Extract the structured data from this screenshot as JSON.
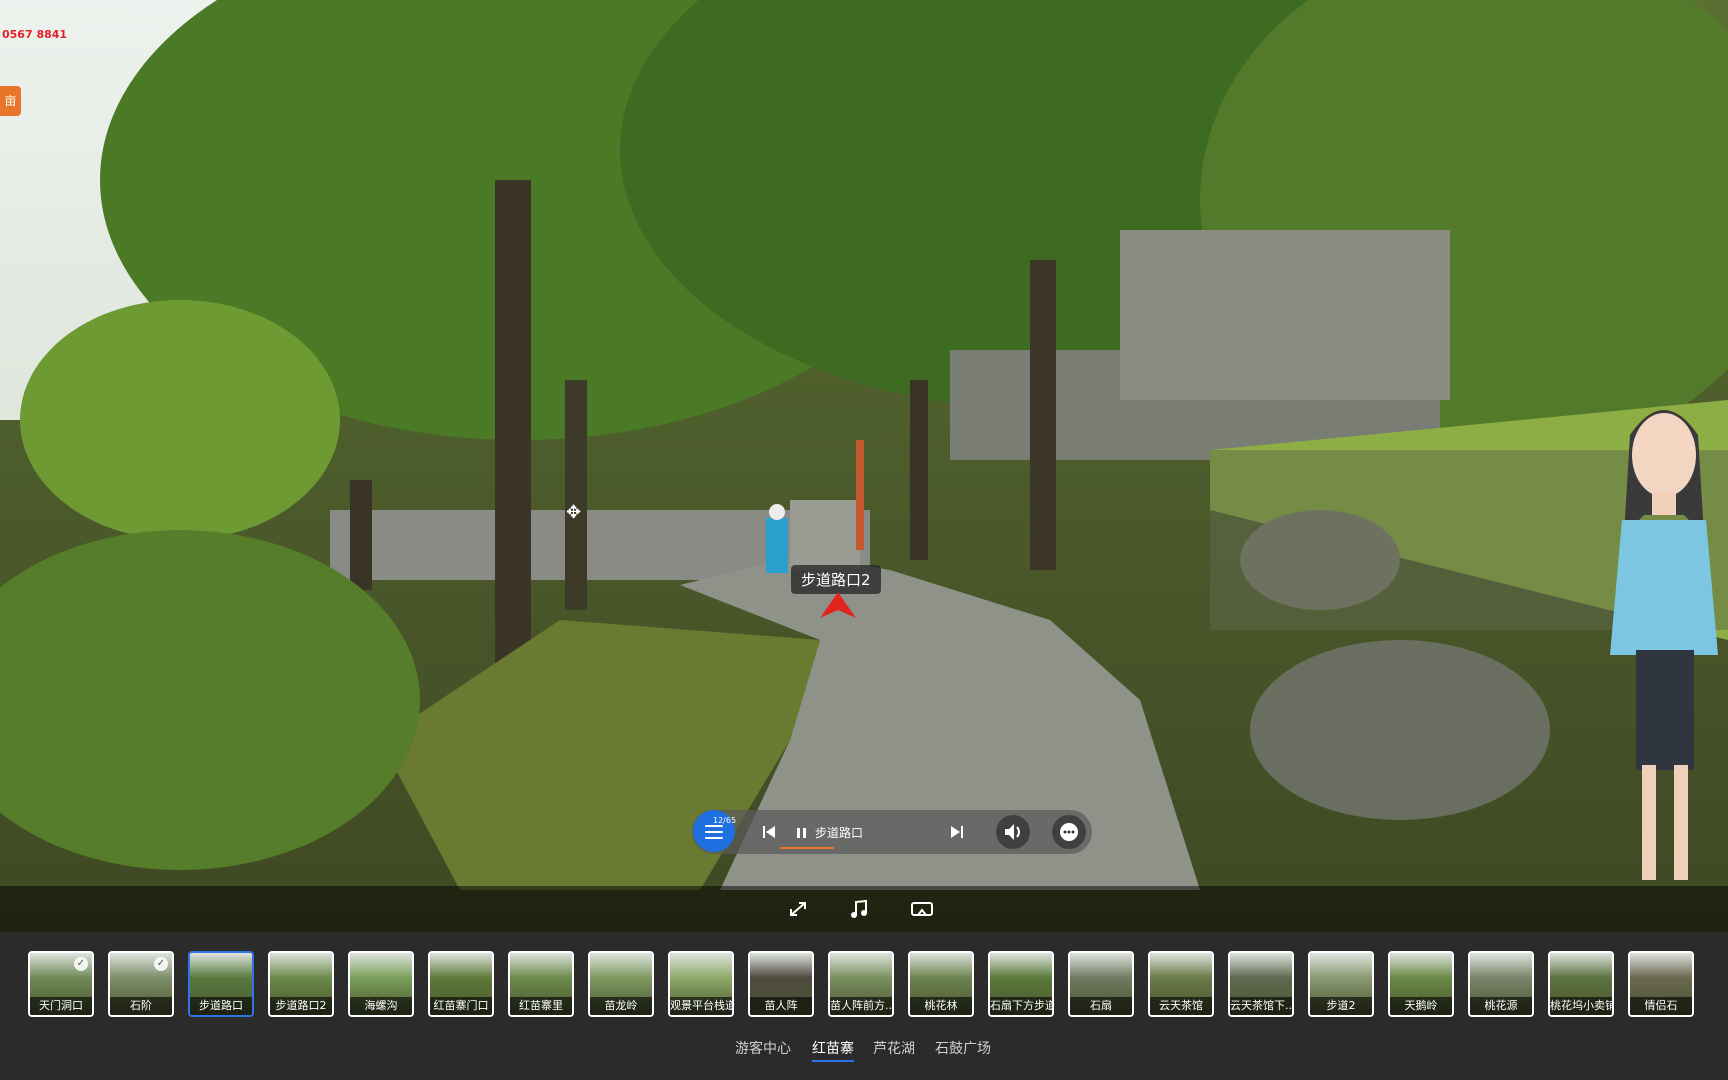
{
  "brand": {
    "logo_text": "0567 8841",
    "side_tab_text": "亩"
  },
  "hotspot": {
    "label": "步道路口2"
  },
  "player": {
    "counter": "12/65",
    "track_name": "步道路口"
  },
  "thumbnails": [
    {
      "label": "天门洞口",
      "visited": true,
      "active": false
    },
    {
      "label": "石阶",
      "visited": true,
      "active": false
    },
    {
      "label": "步道路口",
      "visited": false,
      "active": true
    },
    {
      "label": "步道路口2",
      "visited": false,
      "active": false
    },
    {
      "label": "海螺沟",
      "visited": false,
      "active": false
    },
    {
      "label": "红苗寨门口",
      "visited": false,
      "active": false
    },
    {
      "label": "红苗寨里",
      "visited": false,
      "active": false
    },
    {
      "label": "苗龙岭",
      "visited": false,
      "active": false
    },
    {
      "label": "观景平台栈道",
      "visited": false,
      "active": false
    },
    {
      "label": "苗人阵",
      "visited": false,
      "active": false
    },
    {
      "label": "苗人阵前方...",
      "visited": false,
      "active": false
    },
    {
      "label": "桃花林",
      "visited": false,
      "active": false
    },
    {
      "label": "石扇下方步道",
      "visited": false,
      "active": false
    },
    {
      "label": "石扇",
      "visited": false,
      "active": false
    },
    {
      "label": "云天茶馆",
      "visited": false,
      "active": false
    },
    {
      "label": "云天茶馆下...",
      "visited": false,
      "active": false
    },
    {
      "label": "步道2",
      "visited": false,
      "active": false
    },
    {
      "label": "天鹅岭",
      "visited": false,
      "active": false
    },
    {
      "label": "桃花源",
      "visited": false,
      "active": false
    },
    {
      "label": "桃花坞小卖铺",
      "visited": false,
      "active": false
    },
    {
      "label": "情侣石",
      "visited": false,
      "active": false
    }
  ],
  "groups": [
    {
      "label": "游客中心",
      "active": false
    },
    {
      "label": "红苗寨",
      "active": true
    },
    {
      "label": "芦花湖",
      "active": false
    },
    {
      "label": "石鼓广场",
      "active": false
    }
  ],
  "colors": {
    "accent": "#2e74e8",
    "progress": "#e8762a",
    "hotspot_arrow": "#e0261f"
  }
}
